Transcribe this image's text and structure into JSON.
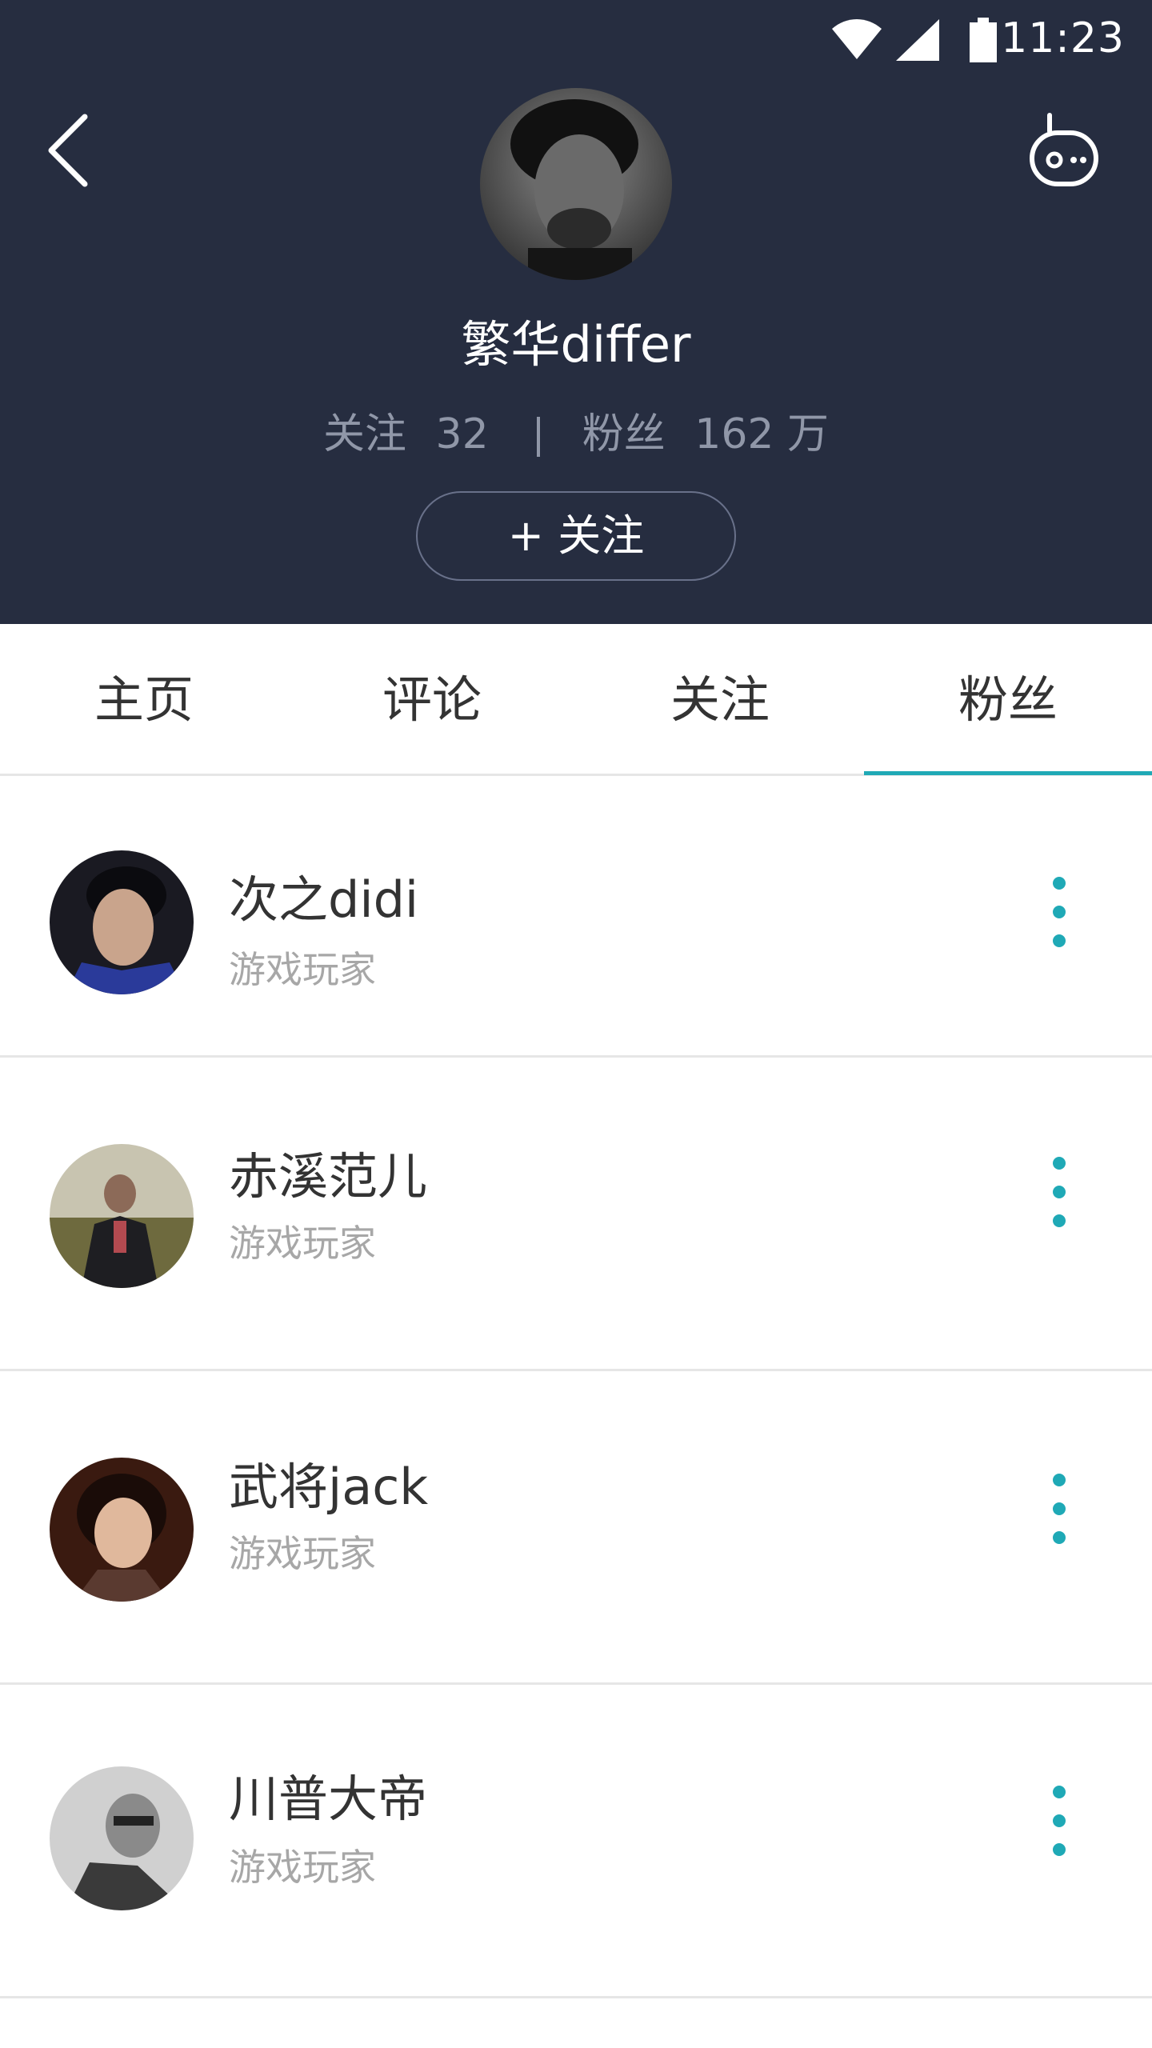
{
  "status_bar": {
    "time": "11:23"
  },
  "profile": {
    "name": "繁华differ",
    "following_label": "关注",
    "following_count": "32",
    "fans_label": "粉丝",
    "fans_count": "162 万",
    "follow_button": "+ 关注"
  },
  "tabs": [
    {
      "label": "主页"
    },
    {
      "label": "评论"
    },
    {
      "label": "关注"
    },
    {
      "label": "粉丝"
    }
  ],
  "active_tab": "粉丝",
  "accent_color": "#1fa9b6",
  "header_color": "#262d40",
  "fans": [
    {
      "name": "次之didi",
      "subtitle": "游戏玩家"
    },
    {
      "name": "赤溪范儿",
      "subtitle": "游戏玩家"
    },
    {
      "name": "武将jack",
      "subtitle": "游戏玩家"
    },
    {
      "name": "川普大帝",
      "subtitle": "游戏玩家"
    }
  ]
}
